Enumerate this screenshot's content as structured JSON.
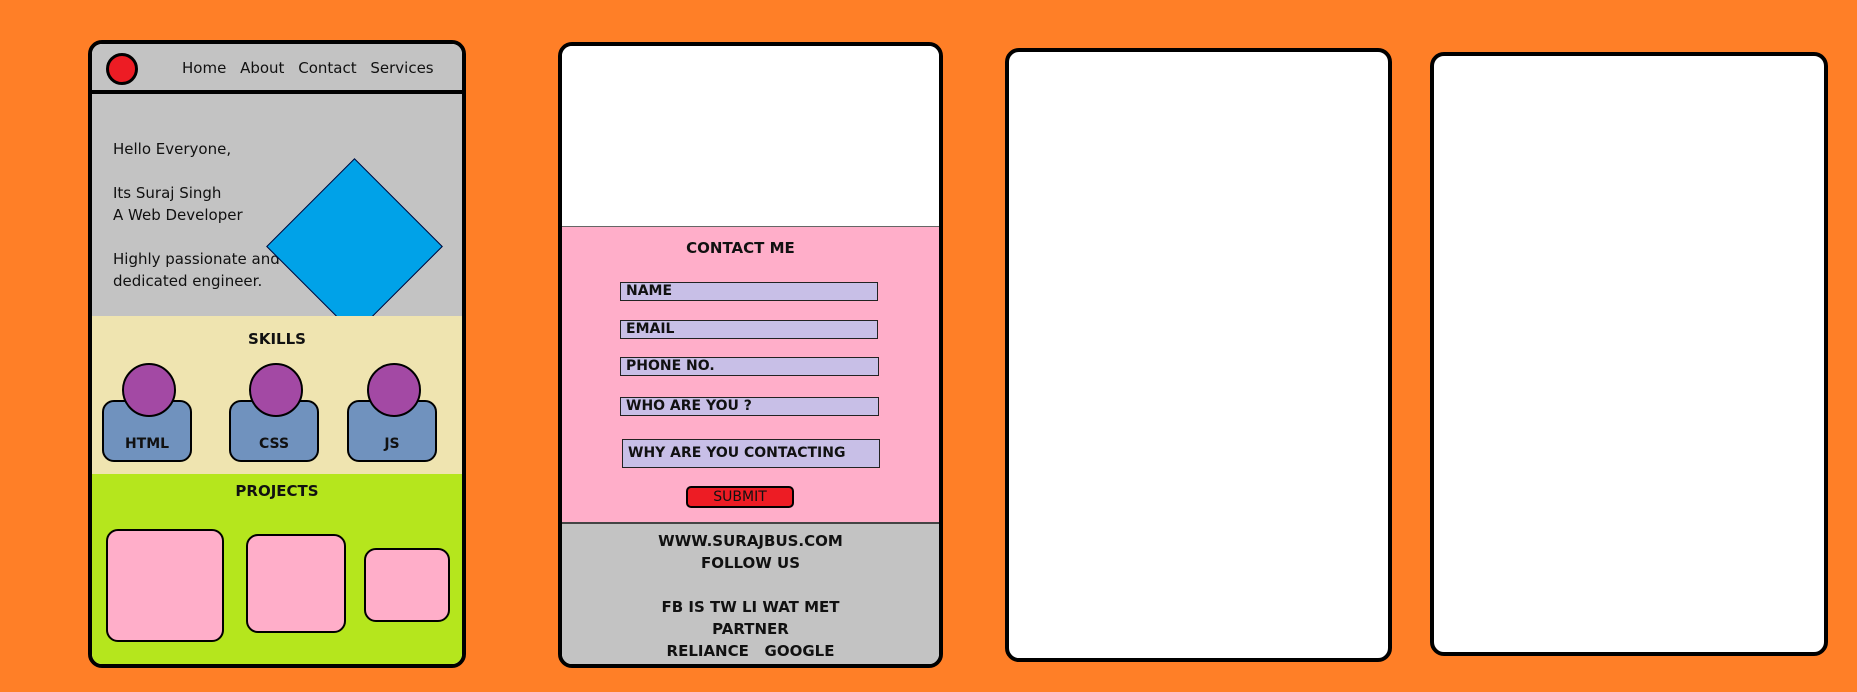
{
  "nav": {
    "items": [
      "Home",
      "About",
      "Contact",
      "Services"
    ]
  },
  "hero": {
    "greeting": "Hello Everyone,",
    "name_line": "Its Suraj Singh",
    "role_line": "A Web Developer",
    "desc_line1": "Highly passionate and",
    "desc_line2": "dedicated engineer."
  },
  "skills": {
    "title": "SKILLS",
    "items": [
      "HTML",
      "CSS",
      "JS"
    ]
  },
  "projects": {
    "title": "PROJECTS"
  },
  "contact": {
    "title": "CONTACT ME",
    "fields": [
      "NAME",
      "EMAIL",
      "PHONE NO.",
      "WHO ARE YOU ?",
      "WHY ARE YOU CONTACTING"
    ],
    "submit": "SUBMIT"
  },
  "footer": {
    "site": "WWW.SURAJBUS.COM",
    "follow": "FOLLOW US",
    "social": "FB IS TW LI WAT  MET",
    "partner": "PARTNER",
    "partners": "RELIANCE   GOOGLE"
  },
  "colors": {
    "background": "#ff7f27",
    "panel_gray": "#c3c3c3",
    "skills_bg": "#efe4b0",
    "projects_bg": "#b5e61d",
    "pink": "#ffaec9",
    "field_lavender": "#c8bfe7",
    "accent_red": "#ed1c24",
    "diamond_blue": "#00a2e8",
    "avatar_purple": "#a349a4",
    "skill_blue": "#7092be"
  }
}
